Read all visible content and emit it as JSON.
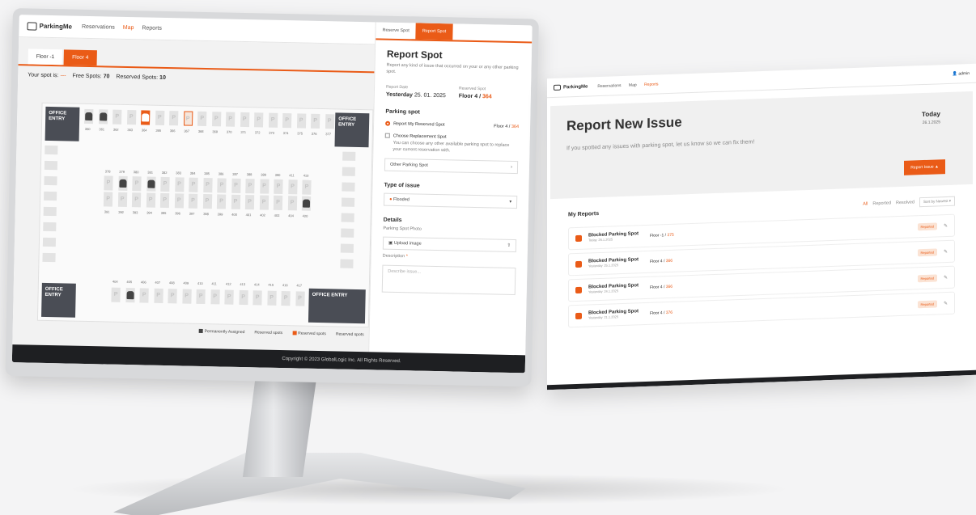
{
  "app": {
    "logo": "ParkingMe",
    "nav": [
      "Reservations",
      "Map",
      "Reports"
    ],
    "nav_active": 1
  },
  "left": {
    "floor_tabs": [
      "Floor -1",
      "Floor 4"
    ],
    "your_spot_label": "Your spot is:",
    "your_spot_value": "---",
    "free_label": "Free Spots:",
    "free_value": "70",
    "reserved_label": "Reserved Spots:",
    "reserved_value": "10",
    "entry_label": "OFFICE ENTRY",
    "top_numbers": [
      "360",
      "361",
      "362",
      "363",
      "364",
      "365",
      "366",
      "367",
      "368",
      "369",
      "370",
      "371",
      "372",
      "373",
      "374",
      "375",
      "376",
      "377"
    ],
    "mid1_numbers": [
      "378",
      "379",
      "380",
      "381",
      "382",
      "383",
      "384",
      "385",
      "386",
      "387",
      "388",
      "389",
      "390",
      "411",
      "410"
    ],
    "mid2_numbers": [
      "391",
      "392",
      "393",
      "394",
      "395",
      "396",
      "397",
      "398",
      "399",
      "400",
      "401",
      "402",
      "403",
      "404",
      "420"
    ],
    "bottom_numbers": [
      "404",
      "405",
      "406",
      "407",
      "408",
      "409",
      "410",
      "411",
      "412",
      "413",
      "414",
      "415",
      "416",
      "417"
    ],
    "legend": [
      "Permanently Assigned",
      "Reserved spots",
      "Reserved spots",
      "Reserved spots"
    ],
    "footer": "Copyright © 2023 GlobalLogic Inc. All Rights Reserved."
  },
  "report": {
    "tabs": [
      "Reserve Spot",
      "Report Spot"
    ],
    "title": "Report Spot",
    "subtitle": "Report any kind of issue that occurred on your or any other parking spot.",
    "date_label": "Report Date",
    "date_value": "Yesterday",
    "date_num": "25. 01. 2025",
    "spot_label": "Reserved Spot",
    "spot_floor": "Floor 4 /",
    "spot_num": "364",
    "parking_section": "Parking spot",
    "opt1": "Report My Reserved Spot",
    "opt1_right": "Floor 4 /",
    "opt1_num": "364",
    "opt2": "Choose Replacement Spot",
    "opt2_desc": "You can choose any other available parking spot to replace your current reservation with.",
    "opt3": "Other Parking Spot",
    "type_section": "Type of issue",
    "type_value": "Flooded",
    "details_section": "Details",
    "photo_label": "Parking Spot Photo",
    "photo_value": "Upload image",
    "desc_label": "Description",
    "desc_placeholder": "Describe issue..."
  },
  "panel": {
    "nav": [
      "Reservations",
      "Map",
      "Reports"
    ],
    "admin": "admin",
    "title": "Report New Issue",
    "subtitle": "If you spotted any issues with parking spot, let us know so we can fix them!",
    "today": "Today",
    "today_date": "26.1.2025",
    "button": "Report Issue",
    "myreports": "My Reports",
    "filters": [
      "All",
      "Reported",
      "Resolved"
    ],
    "sort": "Sort by Newest",
    "rows": [
      {
        "title": "Blocked Parking Spot",
        "day": "Today",
        "date": "26.1.2025",
        "floor": "Floor -1 /",
        "num": "375",
        "badge": "Reported"
      },
      {
        "title": "Blocked Parking Spot",
        "day": "Yesterday",
        "date": "25.1.2025",
        "floor": "Floor 4 /",
        "num": "366",
        "badge": "Reported"
      },
      {
        "title": "Blocked Parking Spot",
        "day": "Yesterday",
        "date": "24.1.2025",
        "floor": "Floor 4 /",
        "num": "366",
        "badge": "Reported"
      },
      {
        "title": "Blocked Parking Spot",
        "day": "Yesterday",
        "date": "21.1.2025",
        "floor": "Floor 4 /",
        "num": "376",
        "badge": "Reported"
      }
    ]
  }
}
